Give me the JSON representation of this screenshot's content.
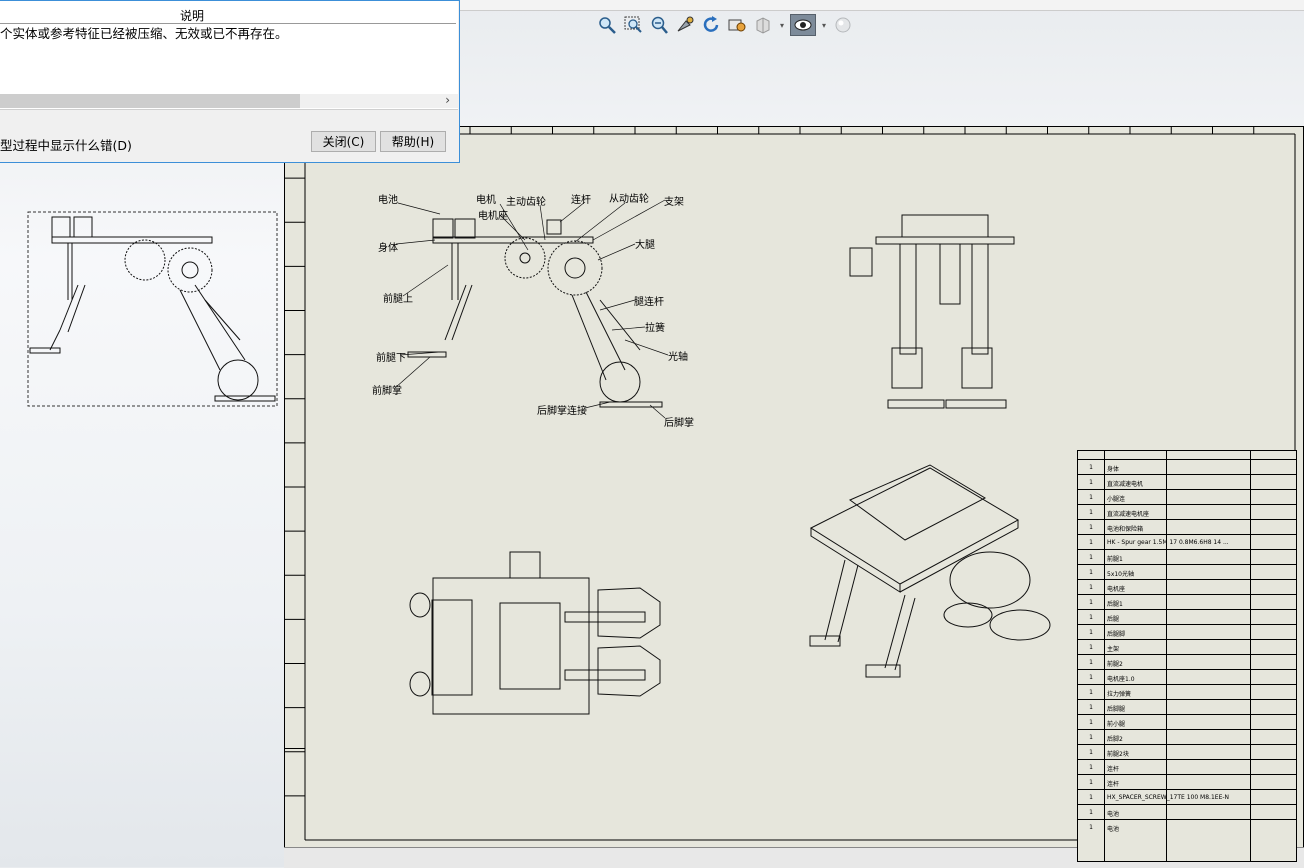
{
  "dialog": {
    "column_header": "说明",
    "message": "个实体或参考特征已经被压缩、无效或已不再存在。",
    "checkbox_label": "型过程中显示什么错(D)",
    "close_label": "关闭(C)",
    "help_label": "帮助(H)"
  },
  "toolbar": {
    "icons": [
      "zoom-to-fit-icon",
      "zoom-to-area-icon",
      "zoom-in-out-icon",
      "pan-icon",
      "rotate-icon",
      "display-style-icon",
      "section-view-icon",
      "view-orientation-icon",
      "appearance-icon"
    ]
  },
  "drawing": {
    "callouts": {
      "battery": "电池",
      "motor": "电机",
      "drive_gear": "主动齿轮",
      "link_rod": "连杆",
      "driven_gear": "从动齿轮",
      "bracket": "支架",
      "motor_seat": "电机座",
      "body": "身体",
      "thigh": "大腿",
      "front_leg_upper": "前腿上",
      "leg_link": "腿连杆",
      "spring": "拉簧",
      "front_leg_lower": "前腿下",
      "shaft": "光轴",
      "front_foot": "前脚掌",
      "rear_foot_link": "后脚掌连接",
      "rear_foot": "后脚掌"
    }
  },
  "bom": {
    "rows": [
      {
        "num": "1",
        "name": "身体"
      },
      {
        "num": "1",
        "name": "直流减速电机"
      },
      {
        "num": "1",
        "name": "小腿连"
      },
      {
        "num": "1",
        "name": "直流减速电机座"
      },
      {
        "num": "1",
        "name": "电池和保险箱"
      },
      {
        "num": "1",
        "name": "HK - Spur gear 1.5M 17 0.8M6.6H8 14 ..."
      },
      {
        "num": "1",
        "name": "前腿1"
      },
      {
        "num": "1",
        "name": "5x10光轴"
      },
      {
        "num": "1",
        "name": "电机座"
      },
      {
        "num": "1",
        "name": "后腿1"
      },
      {
        "num": "1",
        "name": "后腿"
      },
      {
        "num": "1",
        "name": "后腿脚"
      },
      {
        "num": "1",
        "name": "主架"
      },
      {
        "num": "1",
        "name": "前腿2"
      },
      {
        "num": "1",
        "name": "电机座1.0"
      },
      {
        "num": "1",
        "name": "拉力弹簧"
      },
      {
        "num": "1",
        "name": "后脚腿"
      },
      {
        "num": "1",
        "name": "前小腿"
      },
      {
        "num": "1",
        "name": "后脚2"
      },
      {
        "num": "1",
        "name": "前腿2块"
      },
      {
        "num": "1",
        "name": "连杆"
      },
      {
        "num": "1",
        "name": "连杆"
      },
      {
        "num": "1",
        "name": "HX_SPACER_SCREW_17TE 100 M8.1EE-N"
      },
      {
        "num": "1",
        "name": "电池"
      },
      {
        "num": "1",
        "name": "电池"
      }
    ]
  },
  "colors": {
    "sheet": "#e6e6dc",
    "dialog_border": "#3c8fd8",
    "view_active": "#7d8b9a"
  }
}
